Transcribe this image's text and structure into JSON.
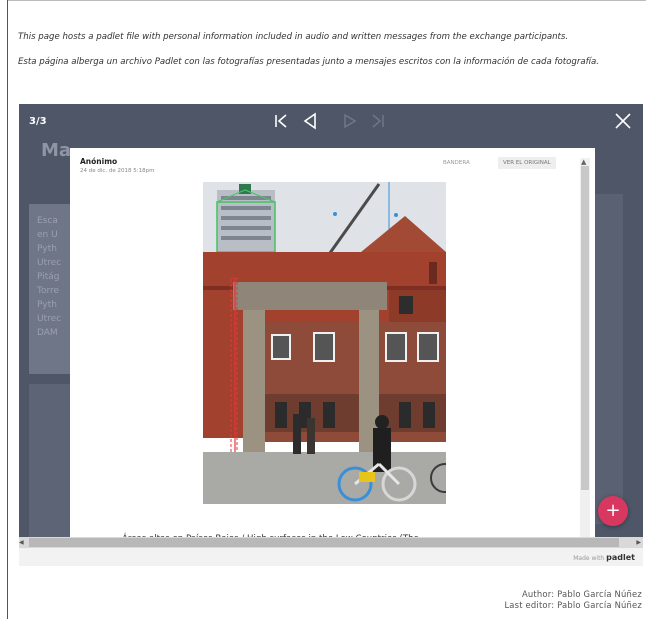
{
  "intro": {
    "english": "This page hosts a padlet file with personal information included in audio and written messages from the exchange participants.",
    "spanish": "Esta página alberga un archivo Padlet con las fotografías presentadas junto a mensajes escritos con la información de cada fotografía."
  },
  "viewer": {
    "counter": "3/3",
    "background": {
      "title": "Ma",
      "card_lines": [
        "Esca",
        "en U",
        "Pyth",
        "Utrec",
        "Pitág",
        "Torre",
        "Pyth",
        "Utrec",
        "DAM"
      ]
    }
  },
  "post": {
    "author": "Anónimo",
    "date": "24 de dic. de 2018 5:18pm",
    "flag_label": "BANDERA",
    "original_label": "VER EL ORIGINAL",
    "caption": "Áreas altas en Países Bajos / High surfaces in the Low Countries (The"
  },
  "fab_label": "+",
  "made_with": {
    "prefix": "Made with",
    "brand": "padlet"
  },
  "footer": {
    "author": "Author: Pablo García Núñez",
    "editor": "Last editor: Pablo García Núñez"
  },
  "colors": {
    "viewer_bg": "#4e5668",
    "fab": "#d8385f",
    "annotation_red": "#e8343a",
    "annotation_blue": "#3a8fd8",
    "annotation_green": "#4cc36a"
  }
}
